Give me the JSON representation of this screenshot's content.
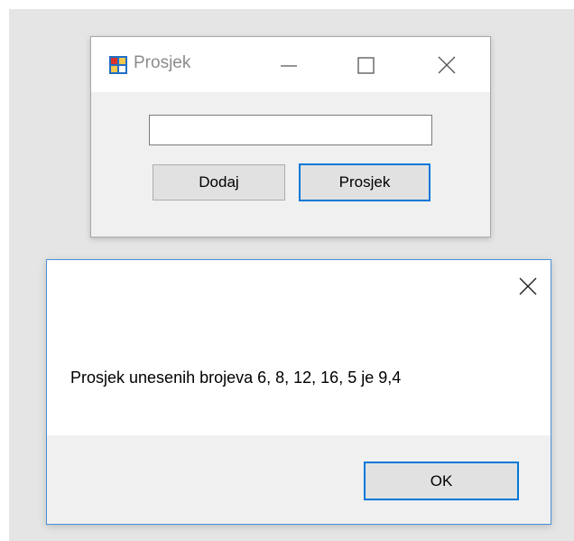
{
  "window": {
    "title": "Prosjek",
    "icon": "forms-app-icon",
    "controls": [
      "minimize-icon",
      "maximize-icon",
      "close-icon"
    ],
    "input": {
      "value": "",
      "placeholder": ""
    },
    "buttons": {
      "dodaj": "Dodaj",
      "prosjek": "Prosjek"
    }
  },
  "message_box": {
    "text": "Prosjek unesenih brojeva 6, 8, 12, 16, 5 je 9,4",
    "ok_label": "OK",
    "close_icon": "close-icon"
  },
  "colors": {
    "accent": "#0078d7",
    "dialog_border": "#4a90d9",
    "window_bg": "#f0f0f0",
    "desktop_bg": "#e5e5e5",
    "title_text": "#8c8c8c"
  }
}
